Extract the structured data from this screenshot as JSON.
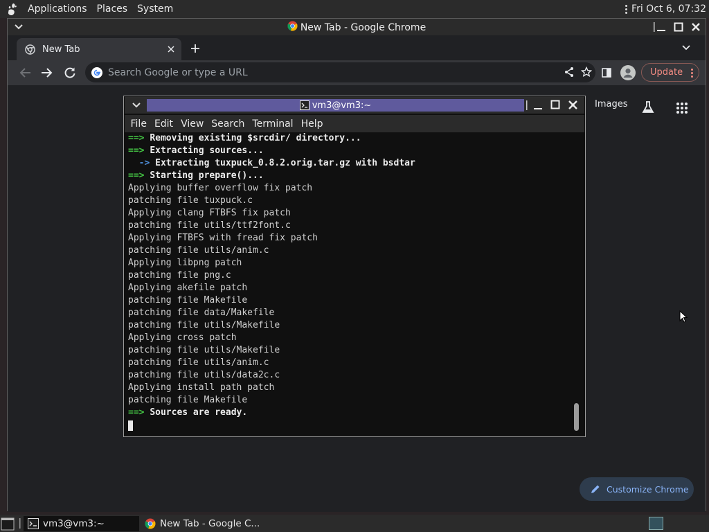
{
  "top_panel": {
    "menus": [
      "Applications",
      "Places",
      "System"
    ],
    "clock": "Fri Oct  6, 07:32"
  },
  "chrome": {
    "window_title": "New Tab - Google Chrome",
    "tab_title": "New Tab",
    "omnibox_placeholder": "Search Google or type a URL",
    "update_label": "Update",
    "images_link": "Images",
    "customize_label": "Customize Chrome",
    "colors": {
      "update_red": "#f28b82",
      "link_blue": "#8ab4f8"
    }
  },
  "terminal": {
    "window_title": "vm3@vm3:~",
    "menus": [
      "File",
      "Edit",
      "View",
      "Search",
      "Terminal",
      "Help"
    ],
    "lines": [
      {
        "prefix": "==> ",
        "text": "Removing existing $srcdir/ directory...",
        "kind": "main"
      },
      {
        "prefix": "==> ",
        "text": "Extracting sources...",
        "kind": "main"
      },
      {
        "prefix": "  -> ",
        "text": "Extracting tuxpuck_0.8.2.orig.tar.gz with bsdtar",
        "kind": "sub"
      },
      {
        "prefix": "==> ",
        "text": "Starting prepare()...",
        "kind": "main"
      },
      {
        "prefix": "",
        "text": "Applying buffer overflow fix patch",
        "kind": "plain"
      },
      {
        "prefix": "",
        "text": "patching file tuxpuck.c",
        "kind": "plain"
      },
      {
        "prefix": "",
        "text": "Applying clang FTBFS fix patch",
        "kind": "plain"
      },
      {
        "prefix": "",
        "text": "patching file utils/ttf2font.c",
        "kind": "plain"
      },
      {
        "prefix": "",
        "text": "Applying FTBFS with fread fix patch",
        "kind": "plain"
      },
      {
        "prefix": "",
        "text": "patching file utils/anim.c",
        "kind": "plain"
      },
      {
        "prefix": "",
        "text": "Applying libpng patch",
        "kind": "plain"
      },
      {
        "prefix": "",
        "text": "patching file png.c",
        "kind": "plain"
      },
      {
        "prefix": "",
        "text": "Applying akefile patch",
        "kind": "plain"
      },
      {
        "prefix": "",
        "text": "patching file Makefile",
        "kind": "plain"
      },
      {
        "prefix": "",
        "text": "patching file data/Makefile",
        "kind": "plain"
      },
      {
        "prefix": "",
        "text": "patching file utils/Makefile",
        "kind": "plain"
      },
      {
        "prefix": "",
        "text": "Applying cross patch",
        "kind": "plain"
      },
      {
        "prefix": "",
        "text": "patching file utils/Makefile",
        "kind": "plain"
      },
      {
        "prefix": "",
        "text": "patching file utils/anim.c",
        "kind": "plain"
      },
      {
        "prefix": "",
        "text": "patching file utils/data2c.c",
        "kind": "plain"
      },
      {
        "prefix": "",
        "text": "Applying install path patch",
        "kind": "plain"
      },
      {
        "prefix": "",
        "text": "patching file Makefile",
        "kind": "plain"
      },
      {
        "prefix": "==> ",
        "text": "Sources are ready.",
        "kind": "main"
      }
    ],
    "colors": {
      "arrow_green": "#43c243",
      "sub_blue": "#4f8fdb",
      "title_purple": "#5f5a9d"
    }
  },
  "taskbar": {
    "items": [
      {
        "label": "vm3@vm3:~",
        "icon": "terminal-icon"
      },
      {
        "label": "New Tab - Google C...",
        "icon": "chrome-icon"
      }
    ]
  }
}
